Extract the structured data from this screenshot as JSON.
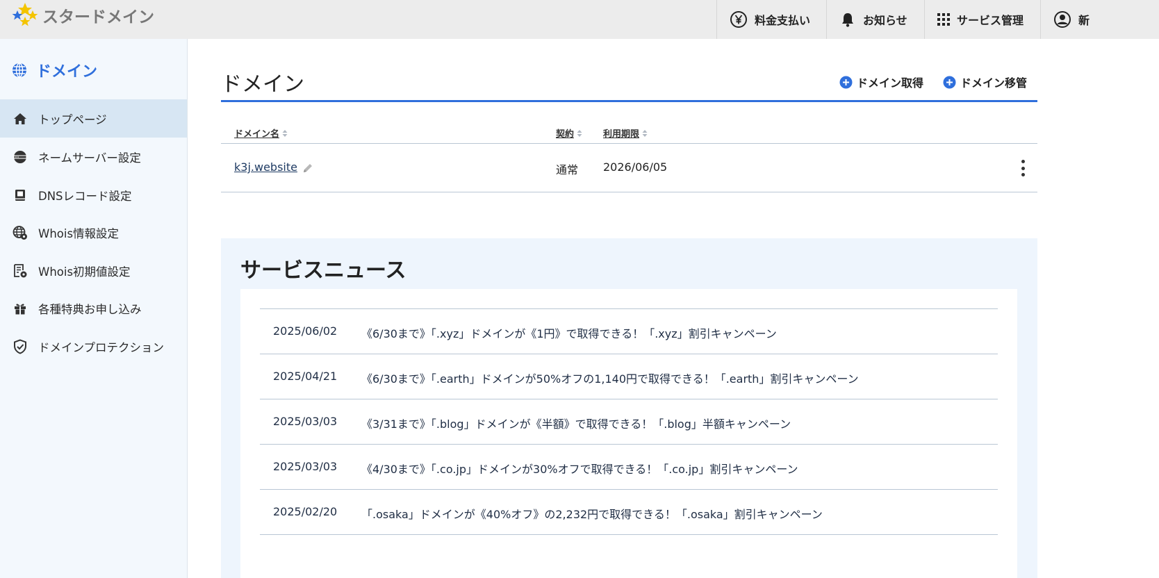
{
  "header": {
    "logo_text": "スタードメイン",
    "nav": [
      {
        "label": "料金支払い",
        "icon": "yen-icon"
      },
      {
        "label": "お知らせ",
        "icon": "bell-icon"
      },
      {
        "label": "サービス管理",
        "icon": "grid-icon"
      },
      {
        "label": "新",
        "icon": "user-icon"
      }
    ]
  },
  "sidebar": {
    "title": "ドメイン",
    "title_icon": "globe-icon",
    "items": [
      {
        "label": "トップページ",
        "icon": "home-icon",
        "active": true
      },
      {
        "label": "ネームサーバー設定",
        "icon": "server-globe-icon"
      },
      {
        "label": "DNSレコード設定",
        "icon": "book-icon"
      },
      {
        "label": "Whois情報設定",
        "icon": "globe-gear-icon"
      },
      {
        "label": "Whois初期値設定",
        "icon": "document-gear-icon"
      },
      {
        "label": "各種特典お申し込み",
        "icon": "gift-icon"
      },
      {
        "label": "ドメインプロテクション",
        "icon": "shield-check-icon"
      }
    ]
  },
  "main": {
    "title": "ドメイン",
    "actions": [
      {
        "label": "ドメイン取得",
        "icon": "plus-circle-icon"
      },
      {
        "label": "ドメイン移管",
        "icon": "plus-circle-icon"
      }
    ],
    "table": {
      "headers": [
        "ドメイン名",
        "契約",
        "利用期限"
      ],
      "rows": [
        {
          "domain": "k3j.website",
          "contract": "通常",
          "expiry": "2026/06/05"
        }
      ]
    }
  },
  "news": {
    "title": "サービスニュース",
    "items": [
      {
        "date": "2025/06/02",
        "text": "《6/30まで》「.xyz」ドメインが《1円》で取得できる！「.xyz」割引キャンペーン"
      },
      {
        "date": "2025/04/21",
        "text": "《6/30まで》「.earth」ドメインが50%オフの1,140円で取得できる！「.earth」割引キャンペーン"
      },
      {
        "date": "2025/03/03",
        "text": "《3/31まで》「.blog」ドメインが《半額》で取得できる！「.blog」半額キャンペーン"
      },
      {
        "date": "2025/03/03",
        "text": "《4/30まで》「.co.jp」ドメインが30%オフで取得できる！「.co.jp」割引キャンペーン"
      },
      {
        "date": "2025/02/20",
        "text": "「.osaka」ドメインが《40%オフ》の2,232円で取得できる！「.osaka」割引キャンペーン"
      }
    ]
  },
  "colors": {
    "accent": "#2f6fdc",
    "sidebar_bg": "#f3f8fd",
    "sidebar_active": "#d7e6f3",
    "header_bg": "#ececec",
    "news_bg": "#eef5fd"
  }
}
